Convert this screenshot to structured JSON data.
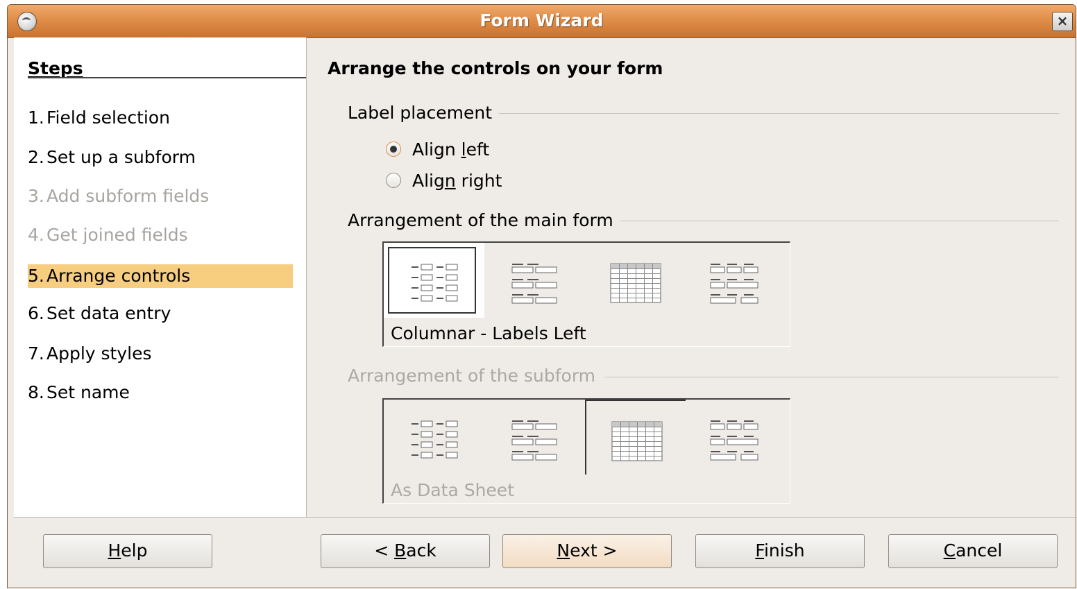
{
  "window": {
    "title": "Form Wizard",
    "close_label": "×"
  },
  "steps": {
    "heading": "Steps",
    "items": [
      {
        "num": "1.",
        "label": "Field selection",
        "state": "enabled"
      },
      {
        "num": "2.",
        "label": "Set up a subform",
        "state": "enabled"
      },
      {
        "num": "3.",
        "label": "Add subform fields",
        "state": "disabled"
      },
      {
        "num": "4.",
        "label": "Get joined fields",
        "state": "disabled"
      },
      {
        "num": "5.",
        "label": "Arrange controls",
        "state": "active"
      },
      {
        "num": "6.",
        "label": "Set data entry",
        "state": "enabled"
      },
      {
        "num": "7.",
        "label": "Apply styles",
        "state": "enabled"
      },
      {
        "num": "8.",
        "label": "Set name",
        "state": "enabled"
      }
    ]
  },
  "content": {
    "heading": "Arrange the controls on your form",
    "label_placement": {
      "group_label": "Label placement",
      "align_left": {
        "pre": "Align ",
        "mnemonic": "l",
        "post": "eft",
        "checked": true
      },
      "align_right": {
        "pre": "Alig",
        "mnemonic": "n",
        "post": " right",
        "checked": false
      }
    },
    "main_form": {
      "group_label": "Arrangement of the main form",
      "selected_index": 0,
      "caption": "Columnar - Labels Left",
      "options": [
        "columnar-labels-left-icon",
        "columnar-labels-top-icon",
        "datasheet-icon",
        "blocks-labels-top-icon"
      ]
    },
    "subform": {
      "group_label": "Arrangement of the subform",
      "enabled": false,
      "selected_index": 2,
      "caption": "As Data Sheet",
      "options": [
        "columnar-labels-left-icon",
        "columnar-labels-top-icon",
        "datasheet-icon",
        "blocks-labels-top-icon"
      ]
    }
  },
  "buttons": {
    "help": {
      "pre": "",
      "mnemonic": "H",
      "post": "elp"
    },
    "back": {
      "pre": "< ",
      "mnemonic": "B",
      "post": "ack"
    },
    "next": {
      "pre": "",
      "mnemonic": "N",
      "post": "ext >"
    },
    "finish": {
      "pre": "",
      "mnemonic": "F",
      "post": "inish"
    },
    "cancel": {
      "pre": "",
      "mnemonic": "C",
      "post": "ancel"
    }
  },
  "colors": {
    "titlebar": "#e08e4a",
    "active_step": "#f7cd80",
    "disabled_text": "#a8a49f",
    "dialog_bg": "#efebe7"
  }
}
